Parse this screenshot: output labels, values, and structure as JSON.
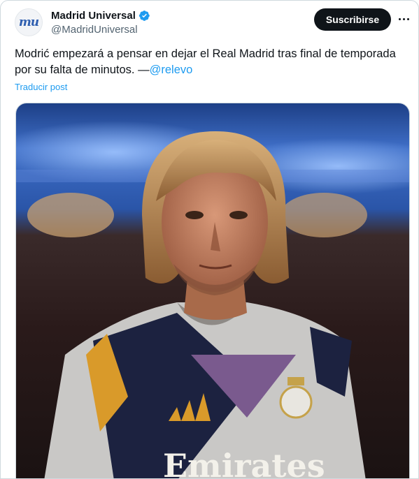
{
  "account": {
    "avatar_text": "mu",
    "display_name": "Madrid Universal",
    "handle": "@MadridUniversal",
    "verified": true
  },
  "actions": {
    "subscribe_label": "Suscribirse",
    "more_icon": "more-horizontal-icon"
  },
  "post": {
    "text": "Modrić empezará a pensar en dejar el Real Madrid tras final de temporada por su falta de minutos. —",
    "mention": "@relevo",
    "translate_label": "Traducir post"
  },
  "media": {
    "shirt_sponsor": "Emirates"
  },
  "colors": {
    "accent": "#1d9bf0",
    "button_bg": "#0f1419",
    "secondary_text": "#536471"
  }
}
